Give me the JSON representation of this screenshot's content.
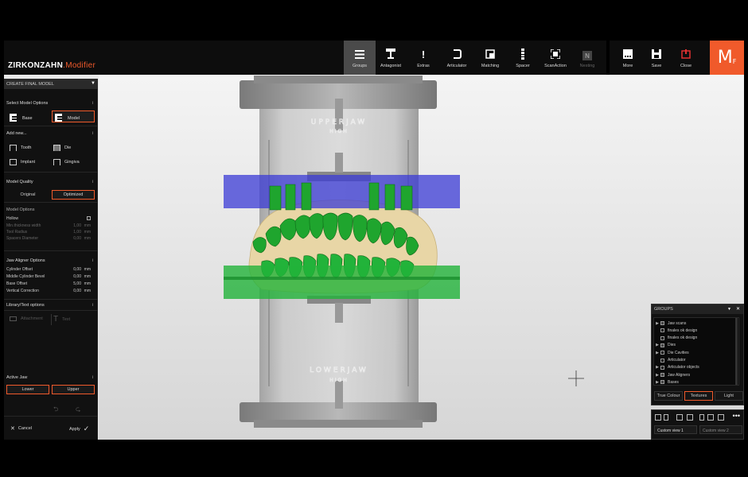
{
  "brand": {
    "part1": "ZIRKONZAHN",
    "part2": ".Modifier"
  },
  "logo": {
    "main": "M",
    "sub": "F"
  },
  "toolbar": {
    "groups": "Groups",
    "antagonist": "Antagonist",
    "extras": "Extras",
    "articulator": "Articulator",
    "matching": "Matching",
    "spacer": "Spacer",
    "scanaction": "ScanAction",
    "nesting": "Nesting",
    "more": "More",
    "save": "Save",
    "close": "Close"
  },
  "icons": {
    "nesting": "N",
    "extras": "!",
    "info": "i",
    "dropdown": "▼",
    "cancel": "✕",
    "apply": "✓",
    "more_dots": "•••"
  },
  "colors": {
    "accent": "#f05a2b",
    "upper_plate": "#3b3bd6",
    "lower_plate": "#22b33a",
    "teeth": "#1fa52e",
    "gingiva": "#e8d6a6"
  },
  "left": {
    "header": "CREATE FINAL MODEL",
    "select_model": {
      "title": "Select Model Options",
      "base": "Base",
      "model": "Model"
    },
    "add_new": {
      "title": "Add new...",
      "tooth": "Tooth",
      "die": "Die",
      "implant": "Implant",
      "gingiva": "Gingiva"
    },
    "quality": {
      "title": "Model Quality",
      "original": "Original",
      "optimized": "Optimized"
    },
    "model_options": {
      "title": "Model Options",
      "hollow": "Hollow",
      "rows": [
        {
          "label": "Min.thickness width",
          "value": "1,00",
          "unit": "mm"
        },
        {
          "label": "Tool Radius",
          "value": "1,00",
          "unit": "mm"
        },
        {
          "label": "Spacers Diameter",
          "value": "0,00",
          "unit": "mm"
        }
      ]
    },
    "jaw_aligner": {
      "title": "Jaw Aligner Options",
      "rows": [
        {
          "label": "Cylinder Offset",
          "value": "0,00",
          "unit": "mm"
        },
        {
          "label": "Middle Cylinder Bevel",
          "value": "0,00",
          "unit": "mm"
        },
        {
          "label": "Base Offset",
          "value": "5,00",
          "unit": "mm"
        },
        {
          "label": "Vertical Correction",
          "value": "0,00",
          "unit": "mm"
        }
      ]
    },
    "library": {
      "title": "Library/Text options",
      "attachment": "Attachment",
      "text": "Text"
    },
    "active_jaw": {
      "title": "Active Jaw",
      "lower": "Lower",
      "upper": "Upper"
    },
    "footer": {
      "cancel": "Cancel",
      "apply": "Apply"
    }
  },
  "groups_panel": {
    "title": "GROUPS",
    "items": [
      {
        "label": "Jaw scans",
        "expand": true,
        "checked": true
      },
      {
        "label": "finales ok design",
        "expand": false,
        "checked": false
      },
      {
        "label": "finales ok design",
        "expand": false,
        "checked": false
      },
      {
        "label": "Dies",
        "expand": true,
        "checked": true
      },
      {
        "label": "Die Cavities",
        "expand": true,
        "checked": false
      },
      {
        "label": "Articulator",
        "expand": false,
        "checked": false
      },
      {
        "label": "Articulator objects",
        "expand": true,
        "checked": false
      },
      {
        "label": "Jaw Aligners",
        "expand": true,
        "checked": true
      },
      {
        "label": "Bases",
        "expand": true,
        "checked": true
      }
    ],
    "buttons": {
      "true_colour": "True Colour",
      "textures": "Textures",
      "light": "Light"
    }
  },
  "views_panel": {
    "view1": "Custom view 1",
    "view2": "Custom view 2"
  },
  "viewport": {
    "upper_label_1": "UPPERJAW",
    "upper_label_2": "HIGH",
    "lower_label_1": "LOWERJAW",
    "lower_label_2": "HIGH"
  }
}
